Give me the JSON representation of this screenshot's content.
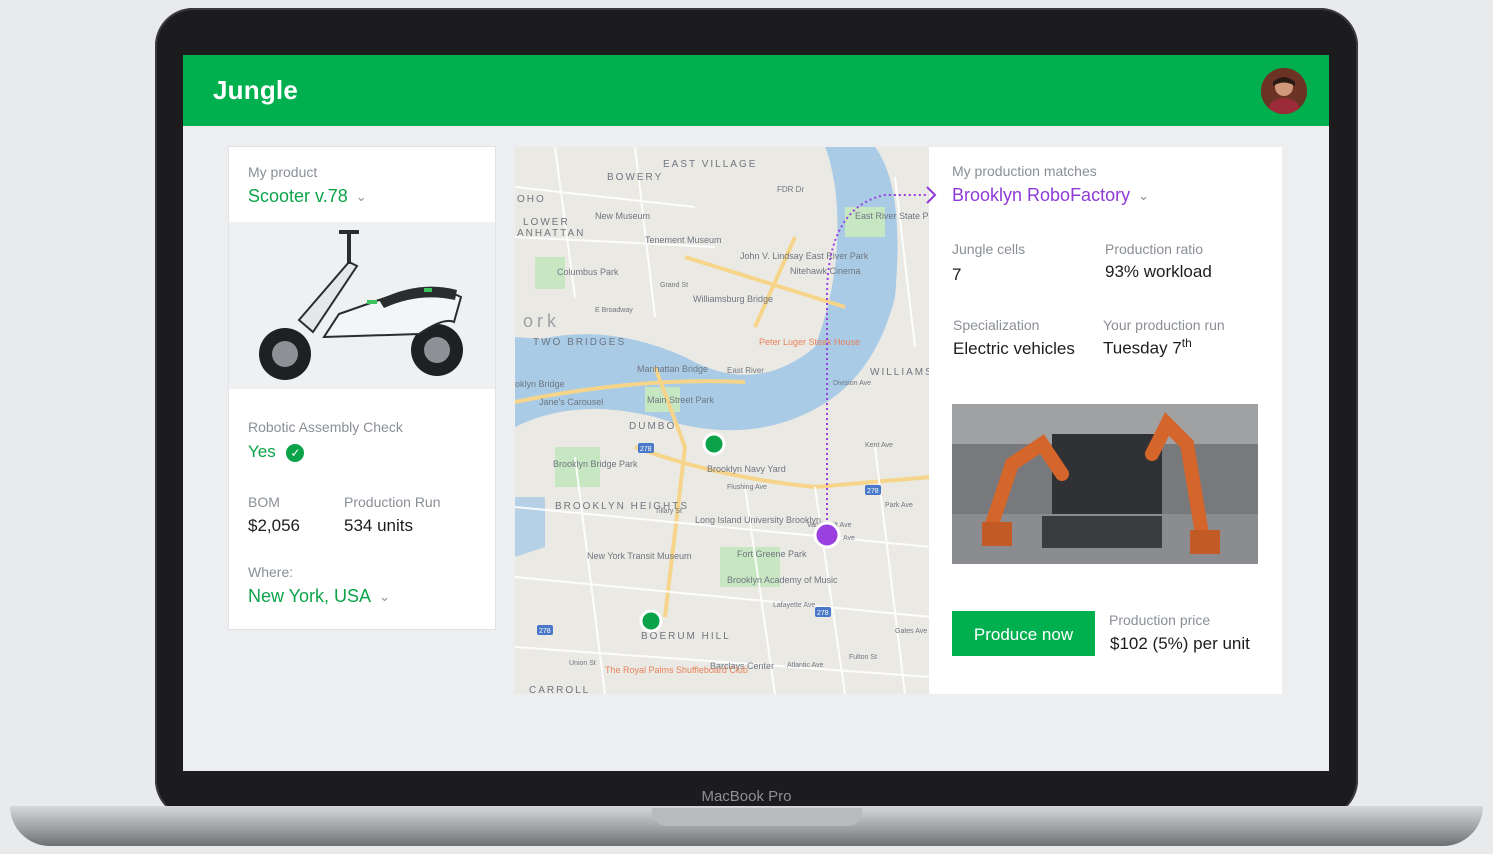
{
  "app": {
    "title": "Jungle",
    "avatar_icon": "user-avatar",
    "accent": "#00b04f"
  },
  "product_card": {
    "my_product_label": "My product",
    "product_name": "Scooter v.78",
    "assembly_label": "Robotic Assembly Check",
    "assembly_value": "Yes",
    "bom_label": "BOM",
    "bom_value": "$2,056",
    "run_label": "Production Run",
    "run_value": "534 units",
    "where_label": "Where:",
    "where_value": "New York, USA"
  },
  "map": {
    "labels": [
      "EAST VILLAGE",
      "BOWERY",
      "OHO",
      "LOWER",
      "ANHATTAN",
      "New Museum",
      "Tenement Museum",
      "John V. Lindsay East River Park",
      "Columbus Park",
      "Grand St",
      "Williamsburg Bridge",
      "East River State Park",
      "Nitehawk Cinema",
      "E Broadway",
      "TWO BRIDGES",
      "Peter Luger Steak House",
      "Manhattan Bridge",
      "East River",
      "oklyn Bridge",
      "Jane's Carousel",
      "Main Street Park",
      "DUMBO",
      "WILLIAMS",
      "Brooklyn Bridge Park",
      "Brooklyn Navy Yard",
      "Flushing Ave",
      "BROOKLYN HEIGHTS",
      "Tillary St",
      "Long Island University Brooklyn",
      "Park Ave",
      "New York Transit Museum",
      "Fort Greene Park",
      "Brooklyn Academy of Music",
      "Lafayette Ave",
      "BOERUM HILL",
      "Barclays Center",
      "Atlantic Ave",
      "Fulton St",
      "The Royal Palms Shuffleboard Club",
      "CARROLL",
      "Union St",
      "Gates Ave",
      "ork",
      "FDR Dr",
      "Vanderbilt Ave",
      "Kent Ave",
      "Division Ave",
      "Ave"
    ],
    "shields": [
      "278",
      "278",
      "278",
      "278"
    ]
  },
  "production_card": {
    "matches_label": "My production matches",
    "match_name": "Brooklyn RoboFactory",
    "cells_label": "Jungle cells",
    "cells_value": "7",
    "ratio_label": "Production ratio",
    "ratio_value": "93% workload",
    "spec_label": "Specialization",
    "spec_value": "Electric vehicles",
    "run_label": "Your production run",
    "run_value": "Tuesday 7",
    "run_sup": "th",
    "produce_button": "Produce now",
    "price_label": "Production price",
    "price_value": "$102 (5%) per unit",
    "match_color": "#8e3ad6"
  },
  "device": {
    "label": "MacBook Pro"
  }
}
